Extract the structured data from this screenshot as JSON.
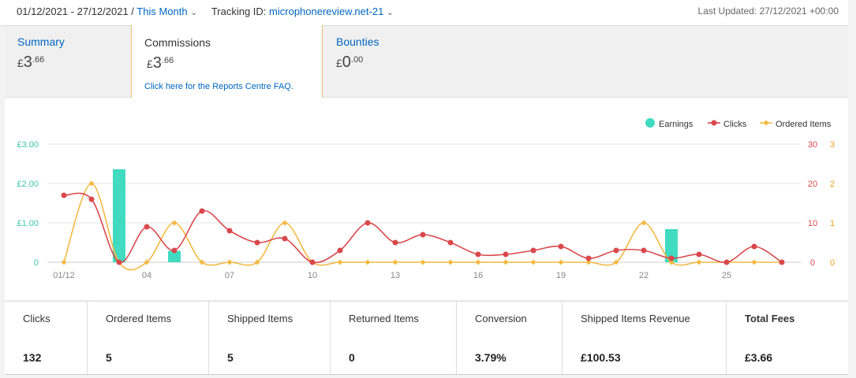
{
  "header": {
    "date_range": "01/12/2021 - 27/12/2021 /",
    "period": "This Month",
    "tracking_label": "Tracking ID:",
    "tracking_id": "microphonereview.net-21",
    "last_updated": "Last Updated: 27/12/2021 +00:00"
  },
  "summary": [
    {
      "label": "Summary",
      "currency": "£",
      "whole": "3",
      "cents": ".66"
    },
    {
      "label": "Bounties",
      "currency": "£",
      "whole": "0",
      "cents": ".00"
    }
  ],
  "popover": {
    "title": "Commissions",
    "currency": "£",
    "whole": "3",
    "cents": ".66",
    "faq_link": "Click here for the Reports Centre FAQ."
  },
  "chart_data": {
    "type": "bar",
    "x_labels": [
      "01/12",
      "04",
      "07",
      "10",
      "13",
      "16",
      "19",
      "22",
      "25"
    ],
    "left_axis": {
      "ticks": [
        "0",
        "£1.00",
        "£2.00",
        "£3.00"
      ],
      "max": 3
    },
    "right_axis_clicks": {
      "ticks": [
        "0",
        "10",
        "20",
        "30"
      ],
      "max": 30
    },
    "right_axis_items": {
      "ticks": [
        "0",
        "1",
        "2",
        "3"
      ],
      "max": 3
    },
    "legend": [
      {
        "name": "Earnings",
        "color": "#40dbc0"
      },
      {
        "name": "Clicks",
        "color": "#d9484c"
      },
      {
        "name": "Ordered Items",
        "color": "#f3b944"
      }
    ],
    "earnings": [
      0,
      0,
      2.36,
      0,
      0.29,
      0,
      0,
      0,
      0,
      0,
      0,
      0,
      0,
      0,
      0,
      0,
      0,
      0,
      0,
      0,
      0,
      0,
      0.84,
      0,
      0,
      0,
      0
    ],
    "clicks": [
      17,
      16,
      0,
      9,
      3,
      13,
      8,
      5,
      6,
      0,
      3,
      10,
      5,
      7,
      5,
      2,
      2,
      3,
      4,
      1,
      3,
      3,
      1,
      2,
      0,
      4,
      0
    ],
    "ordered_items": [
      0,
      2,
      0,
      0,
      1,
      0,
      0,
      0,
      1,
      0,
      0,
      0,
      0,
      0,
      0,
      0,
      0,
      0,
      0,
      0,
      0,
      1,
      0,
      0,
      0,
      0,
      0
    ],
    "grid": true,
    "legend_position": "top-right"
  },
  "metrics": [
    {
      "label": "Clicks",
      "value": "132"
    },
    {
      "label": "Ordered Items",
      "value": "5"
    },
    {
      "label": "Shipped Items",
      "value": "5"
    },
    {
      "label": "Returned Items",
      "value": "0"
    },
    {
      "label": "Conversion",
      "value": "3.79%"
    },
    {
      "label": "Shipped Items Revenue",
      "value": "£100.53"
    },
    {
      "label": "Total Fees",
      "value": "£3.66"
    }
  ]
}
